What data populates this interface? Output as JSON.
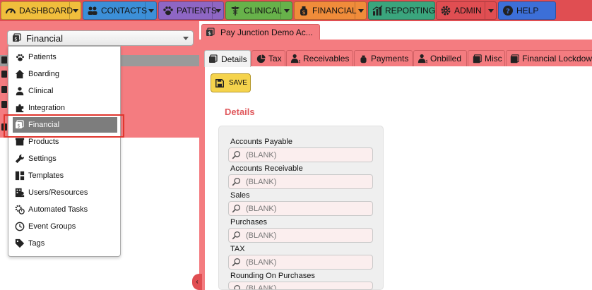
{
  "nav": {
    "dashboard": {
      "label": "DASHBOARD",
      "color": "#f0be3c",
      "icon": "dashboard-gauge-icon"
    },
    "contacts": {
      "label": "CONTACTS",
      "color": "#3c8fd8",
      "icon": "contacts-group-icon"
    },
    "patients": {
      "label": "PATIENTS",
      "color": "#8e66c4",
      "icon": "paw-icon"
    },
    "clinical": {
      "label": "CLINICAL",
      "color": "#67b24a",
      "icon": "caduceus-icon"
    },
    "financial": {
      "label": "FINANCIAL",
      "color": "#f08c3a",
      "icon": "money-bag-icon"
    },
    "reporting": {
      "label": "REPORTING",
      "color": "#3aa57d",
      "icon": "chart-icon"
    },
    "admin": {
      "label": "ADMIN",
      "color": "#e04e52",
      "icon": "gear-icon"
    },
    "help": {
      "label": "HELP",
      "color": "#3c6fd8",
      "icon": "question-icon"
    }
  },
  "module_select": {
    "value": "Financial",
    "icon": "financial-icon"
  },
  "module_menu": {
    "items": [
      {
        "label": "Patients",
        "icon": "paw-icon"
      },
      {
        "label": "Boarding",
        "icon": "house-icon"
      },
      {
        "label": "Clinical",
        "icon": "doctor-icon"
      },
      {
        "label": "Integration",
        "icon": "puzzle-icon"
      },
      {
        "label": "Financial",
        "icon": "financial-icon",
        "selected": true
      },
      {
        "label": "Products",
        "icon": "box-icon"
      },
      {
        "label": "Settings",
        "icon": "wrench-icon"
      },
      {
        "label": "Templates",
        "icon": "template-icon"
      },
      {
        "label": "Users/Resources",
        "icon": "users-icon"
      },
      {
        "label": "Automated Tasks",
        "icon": "automated-gear-icon"
      },
      {
        "label": "Event Groups",
        "icon": "clock-icon"
      },
      {
        "label": "Tags",
        "icon": "tag-icon"
      }
    ]
  },
  "document_tab": {
    "label": "Pay Junction Demo Ac..."
  },
  "tabs": [
    {
      "label": "Details",
      "icon": "financial-icon",
      "active": true
    },
    {
      "label": "Tax",
      "icon": "pie-icon"
    },
    {
      "label": "Receivables",
      "icon": "receivables-icon"
    },
    {
      "label": "Payments",
      "icon": "payments-icon"
    },
    {
      "label": "Onbilled",
      "icon": "onbilled-icon"
    },
    {
      "label": "Misc",
      "icon": "misc-icon"
    },
    {
      "label": "Financial Lockdow",
      "icon": "lockdown-icon"
    }
  ],
  "toolbar": {
    "save_label": "SAVE"
  },
  "details": {
    "title": "Details",
    "fields": [
      {
        "label": "Accounts Payable",
        "value": "(BLANK)"
      },
      {
        "label": "Accounts Receivable",
        "value": "(BLANK)"
      },
      {
        "label": "Sales",
        "value": "(BLANK)"
      },
      {
        "label": "Purchases",
        "value": "(BLANK)"
      },
      {
        "label": "TAX",
        "value": "(BLANK)"
      },
      {
        "label": "Rounding On Purchases",
        "value": "(BLANK)"
      }
    ]
  },
  "collapse_handle": {
    "glyph": "‹"
  }
}
